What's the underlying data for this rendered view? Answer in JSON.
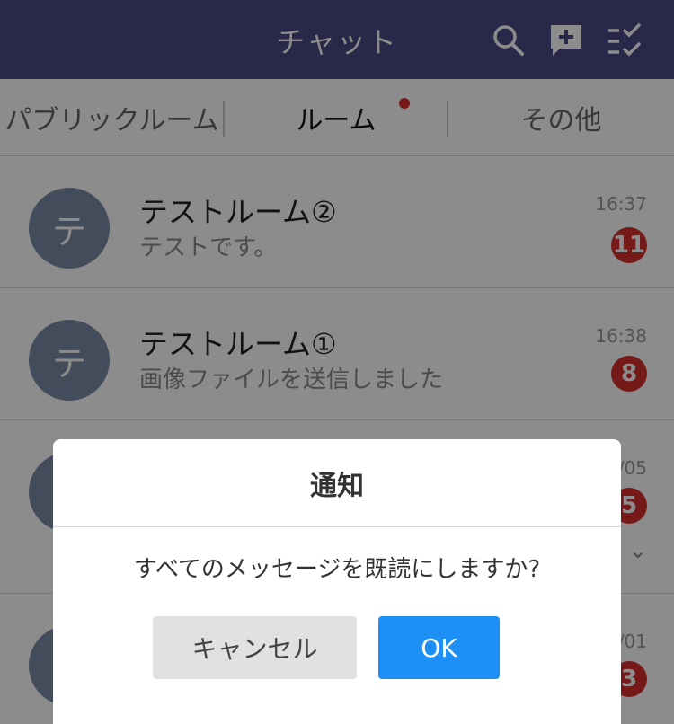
{
  "header": {
    "title": "チャット",
    "icons": [
      "search-icon",
      "new-chat-icon",
      "check-list-icon"
    ]
  },
  "tabs": [
    {
      "label": "パブリックルーム"
    },
    {
      "label": "ルーム",
      "selected": true,
      "has_unread_dot": true
    },
    {
      "label": "その他"
    }
  ],
  "rooms": [
    {
      "avatar": "テ",
      "name": "テストルーム②",
      "last_message": "テストです。",
      "time": "16:37",
      "unread": "11"
    },
    {
      "avatar": "テ",
      "name": "テストルーム①",
      "last_message": "画像ファイルを送信しました",
      "time": "16:38",
      "unread": "8"
    },
    {
      "avatar": "",
      "name": "",
      "last_message": "",
      "time": "/05",
      "unread": "5"
    },
    {
      "avatar": "",
      "name": "",
      "last_message": "",
      "time": "/01",
      "unread": "3"
    }
  ],
  "dialog": {
    "title": "通知",
    "message": "すべてのメッセージを既読にしますか?",
    "cancel_label": "キャンセル",
    "ok_label": "OK"
  },
  "colors": {
    "header_bg": "#4b4a85",
    "badge": "#d6312f",
    "ok_button": "#1d8ff5",
    "avatar_bg": "#7a8aa6"
  }
}
